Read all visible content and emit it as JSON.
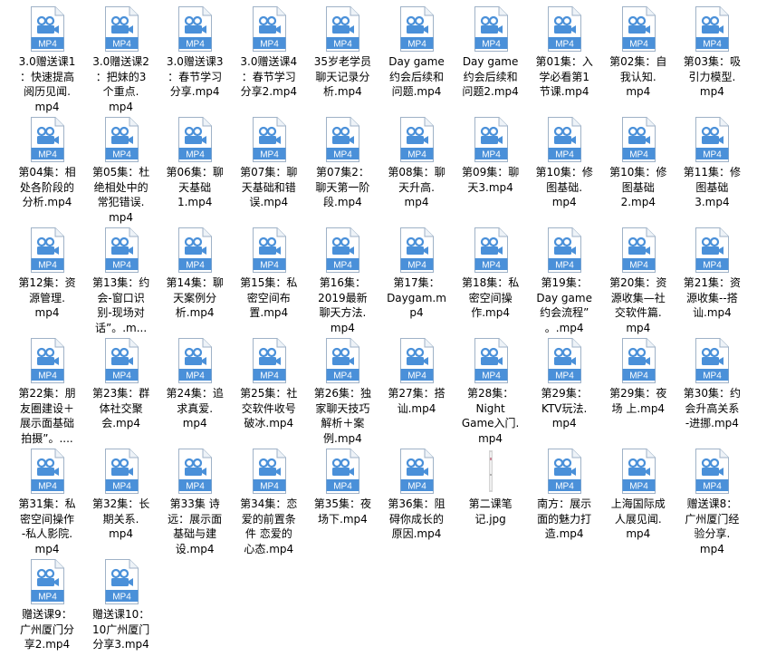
{
  "colors": {
    "icon_page": "#ffffff",
    "icon_border": "#9fb2c7",
    "icon_accent": "#4a90d9",
    "icon_badge_text": "#ffffff",
    "icon_symbol": "#4a90d9",
    "jpg_strip": "#d4d4d4",
    "label_text": "#000000"
  },
  "files": [
    {
      "type": "MP4",
      "badge": "MP4",
      "icon": "video-file-icon",
      "label": "3.0赠送课1\n：快速提高\n阅历见闻.\nmp4"
    },
    {
      "type": "MP4",
      "badge": "MP4",
      "icon": "video-file-icon",
      "label": "3.0赠送课2\n：把妹的3\n个重点.\nmp4"
    },
    {
      "type": "MP4",
      "badge": "MP4",
      "icon": "video-file-icon",
      "label": "3.0赠送课3\n：春节学习\n分享.mp4"
    },
    {
      "type": "MP4",
      "badge": "MP4",
      "icon": "video-file-icon",
      "label": "3.0赠送课4\n：春节学习\n分享2.mp4"
    },
    {
      "type": "MP4",
      "badge": "MP4",
      "icon": "video-file-icon",
      "label": "35岁老学员\n聊天记录分\n析.mp4"
    },
    {
      "type": "MP4",
      "badge": "MP4",
      "icon": "video-file-icon",
      "label": "Day game\n约会后续和\n问题.mp4"
    },
    {
      "type": "MP4",
      "badge": "MP4",
      "icon": "video-file-icon",
      "label": "Day game\n约会后续和\n问题2.mp4"
    },
    {
      "type": "MP4",
      "badge": "MP4",
      "icon": "video-file-icon",
      "label": "第01集：入\n学必看第1\n节课.mp4"
    },
    {
      "type": "MP4",
      "badge": "MP4",
      "icon": "video-file-icon",
      "label": "第02集：自\n我认知.\nmp4"
    },
    {
      "type": "MP4",
      "badge": "MP4",
      "icon": "video-file-icon",
      "label": "第03集：吸\n引力模型.\nmp4"
    },
    {
      "type": "MP4",
      "badge": "MP4",
      "icon": "video-file-icon",
      "label": "第04集：相\n处各阶段的\n分析.mp4"
    },
    {
      "type": "MP4",
      "badge": "MP4",
      "icon": "video-file-icon",
      "label": "第05集：杜\n绝相处中的\n常犯错误.\nmp4"
    },
    {
      "type": "MP4",
      "badge": "MP4",
      "icon": "video-file-icon",
      "label": "第06集：聊\n天基础\n1.mp4"
    },
    {
      "type": "MP4",
      "badge": "MP4",
      "icon": "video-file-icon",
      "label": "第07集：聊\n天基础和错\n误.mp4"
    },
    {
      "type": "MP4",
      "badge": "MP4",
      "icon": "video-file-icon",
      "label": "第07集2：\n聊天第一阶\n段.mp4"
    },
    {
      "type": "MP4",
      "badge": "MP4",
      "icon": "video-file-icon",
      "label": "第08集：聊\n天升高.\nmp4"
    },
    {
      "type": "MP4",
      "badge": "MP4",
      "icon": "video-file-icon",
      "label": "第09集：聊\n天3.mp4"
    },
    {
      "type": "MP4",
      "badge": "MP4",
      "icon": "video-file-icon",
      "label": "第10集：修\n图基础.\nmp4"
    },
    {
      "type": "MP4",
      "badge": "MP4",
      "icon": "video-file-icon",
      "label": "第10集：修\n图基础\n2.mp4"
    },
    {
      "type": "MP4",
      "badge": "MP4",
      "icon": "video-file-icon",
      "label": "第11集：修\n图基础\n3.mp4"
    },
    {
      "type": "MP4",
      "badge": "MP4",
      "icon": "video-file-icon",
      "label": "第12集：资\n源管理.\nmp4"
    },
    {
      "type": "MP4",
      "badge": "MP4",
      "icon": "video-file-icon",
      "label": "第13集：约\n会-窗口识\n别-现场对\n话”。.m..."
    },
    {
      "type": "MP4",
      "badge": "MP4",
      "icon": "video-file-icon",
      "label": "第14集：聊\n天案例分\n析.mp4"
    },
    {
      "type": "MP4",
      "badge": "MP4",
      "icon": "video-file-icon",
      "label": "第15集：私\n密空间布\n置.mp4"
    },
    {
      "type": "MP4",
      "badge": "MP4",
      "icon": "video-file-icon",
      "label": "第16集：\n2019最新\n聊天方法.\nmp4"
    },
    {
      "type": "MP4",
      "badge": "MP4",
      "icon": "video-file-icon",
      "label": "第17集：\nDaygam.m\np4"
    },
    {
      "type": "MP4",
      "badge": "MP4",
      "icon": "video-file-icon",
      "label": "第18集：私\n密空间操\n作.mp4"
    },
    {
      "type": "MP4",
      "badge": "MP4",
      "icon": "video-file-icon",
      "label": "第19集：\nDay game\n约会流程”\n。.mp4"
    },
    {
      "type": "MP4",
      "badge": "MP4",
      "icon": "video-file-icon",
      "label": "第20集：资\n源收集—社\n交软件篇.\nmp4"
    },
    {
      "type": "MP4",
      "badge": "MP4",
      "icon": "video-file-icon",
      "label": "第21集：资\n源收集--搭\n讪.mp4"
    },
    {
      "type": "MP4",
      "badge": "MP4",
      "icon": "video-file-icon",
      "label": "第22集：朋\n友圈建设＋\n展示面基础\n拍摄”。...."
    },
    {
      "type": "MP4",
      "badge": "MP4",
      "icon": "video-file-icon",
      "label": "第23集：群\n体社交聚\n会.mp4"
    },
    {
      "type": "MP4",
      "badge": "MP4",
      "icon": "video-file-icon",
      "label": "第24集：追\n求真爱.\nmp4"
    },
    {
      "type": "MP4",
      "badge": "MP4",
      "icon": "video-file-icon",
      "label": "第25集：社\n交软件收号\n破冰.mp4"
    },
    {
      "type": "MP4",
      "badge": "MP4",
      "icon": "video-file-icon",
      "label": "第26集：独\n家聊天技巧\n解析＋案\n例.mp4"
    },
    {
      "type": "MP4",
      "badge": "MP4",
      "icon": "video-file-icon",
      "label": "第27集：搭\n讪.mp4"
    },
    {
      "type": "MP4",
      "badge": "MP4",
      "icon": "video-file-icon",
      "label": "第28集：\nNight\nGame入门.\nmp4"
    },
    {
      "type": "MP4",
      "badge": "MP4",
      "icon": "video-file-icon",
      "label": "第29集：\nKTV玩法.\nmp4"
    },
    {
      "type": "MP4",
      "badge": "MP4",
      "icon": "video-file-icon",
      "label": "第29集：夜\n场 上.mp4"
    },
    {
      "type": "MP4",
      "badge": "MP4",
      "icon": "video-file-icon",
      "label": "第30集：约\n会升高关系\n-进挪.mp4"
    },
    {
      "type": "MP4",
      "badge": "MP4",
      "icon": "video-file-icon",
      "label": "第31集：私\n密空间操作\n-私人影院.\nmp4"
    },
    {
      "type": "MP4",
      "badge": "MP4",
      "icon": "video-file-icon",
      "label": "第32集：长\n期关系.\nmp4"
    },
    {
      "type": "MP4",
      "badge": "MP4",
      "icon": "video-file-icon",
      "label": "第33集 诗\n远：展示面\n基础与建\n设.mp4"
    },
    {
      "type": "MP4",
      "badge": "MP4",
      "icon": "video-file-icon",
      "label": "第34集：恋\n爱的前置条\n件 恋爱的\n心态.mp4"
    },
    {
      "type": "MP4",
      "badge": "MP4",
      "icon": "video-file-icon",
      "label": "第35集：夜\n场下.mp4"
    },
    {
      "type": "MP4",
      "badge": "MP4",
      "icon": "video-file-icon",
      "label": "第36集：阻\n碍你成长的\n原因.mp4"
    },
    {
      "type": "JPG",
      "badge": "",
      "icon": "image-file-icon",
      "label": "第二课笔\n记.jpg"
    },
    {
      "type": "MP4",
      "badge": "MP4",
      "icon": "video-file-icon",
      "label": "南方：展示\n面的魅力打\n造.mp4"
    },
    {
      "type": "MP4",
      "badge": "MP4",
      "icon": "video-file-icon",
      "label": "上海国际成\n人展见闻.\nmp4"
    },
    {
      "type": "MP4",
      "badge": "MP4",
      "icon": "video-file-icon",
      "label": "赠送课8：\n广州厦门经\n验分享.\nmp4"
    },
    {
      "type": "MP4",
      "badge": "MP4",
      "icon": "video-file-icon",
      "label": "赠送课9：\n广州厦门分\n享2.mp4"
    },
    {
      "type": "MP4",
      "badge": "MP4",
      "icon": "video-file-icon",
      "label": "赠送课10：\n10广州厦门\n分享3.mp4"
    }
  ]
}
